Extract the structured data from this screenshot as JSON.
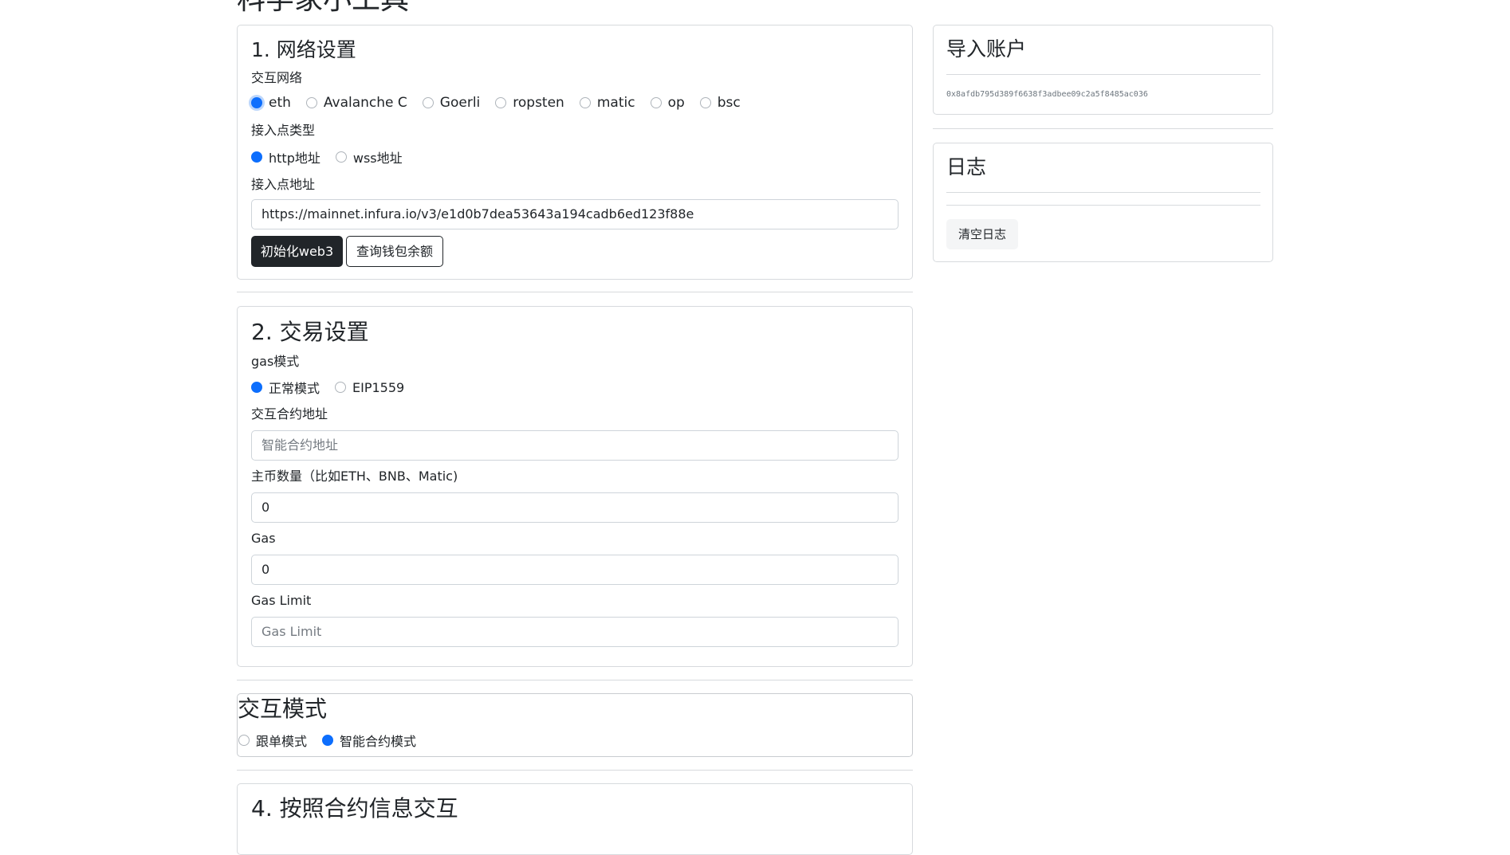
{
  "page": {
    "title": "科学家小工具"
  },
  "network": {
    "title": "1. 网络设置",
    "network_label": "交互网络",
    "networks": [
      "eth",
      "Avalanche C",
      "Goerli",
      "ropsten",
      "matic",
      "op",
      "bsc"
    ],
    "selected_network": "eth",
    "endpoint_type_label": "接入点类型",
    "endpoint_types": [
      "http地址",
      "wss地址"
    ],
    "selected_endpoint_type": "http地址",
    "endpoint_label": "接入点地址",
    "endpoint_value": "https://mainnet.infura.io/v3/e1d0b7dea53643a194cadb6ed123f88e",
    "init_button": "初始化web3",
    "balance_button": "查询钱包余额"
  },
  "trade": {
    "title": "2. 交易设置",
    "gas_mode_label": "gas模式",
    "gas_modes": [
      "正常模式",
      "EIP1559"
    ],
    "selected_gas_mode": "正常模式",
    "contract_label": "交互合约地址",
    "contract_placeholder": "智能合约地址",
    "amount_label": "主币数量（比如ETH、BNB、Matic)",
    "amount_value": "0",
    "gas_label": "Gas",
    "gas_value": "0",
    "gas_limit_label": "Gas Limit",
    "gas_limit_placeholder": "Gas Limit"
  },
  "mode": {
    "title": "交互模式",
    "options": [
      "跟单模式",
      "智能合约模式"
    ],
    "selected": "智能合约模式"
  },
  "contract_interact": {
    "title": "4. 按照合约信息交互"
  },
  "account": {
    "title": "导入账户",
    "address": "0x8afdb795d389f6638f3adbee09c2a5f8485ac036"
  },
  "log": {
    "title": "日志",
    "clear_button": "清空日志"
  }
}
